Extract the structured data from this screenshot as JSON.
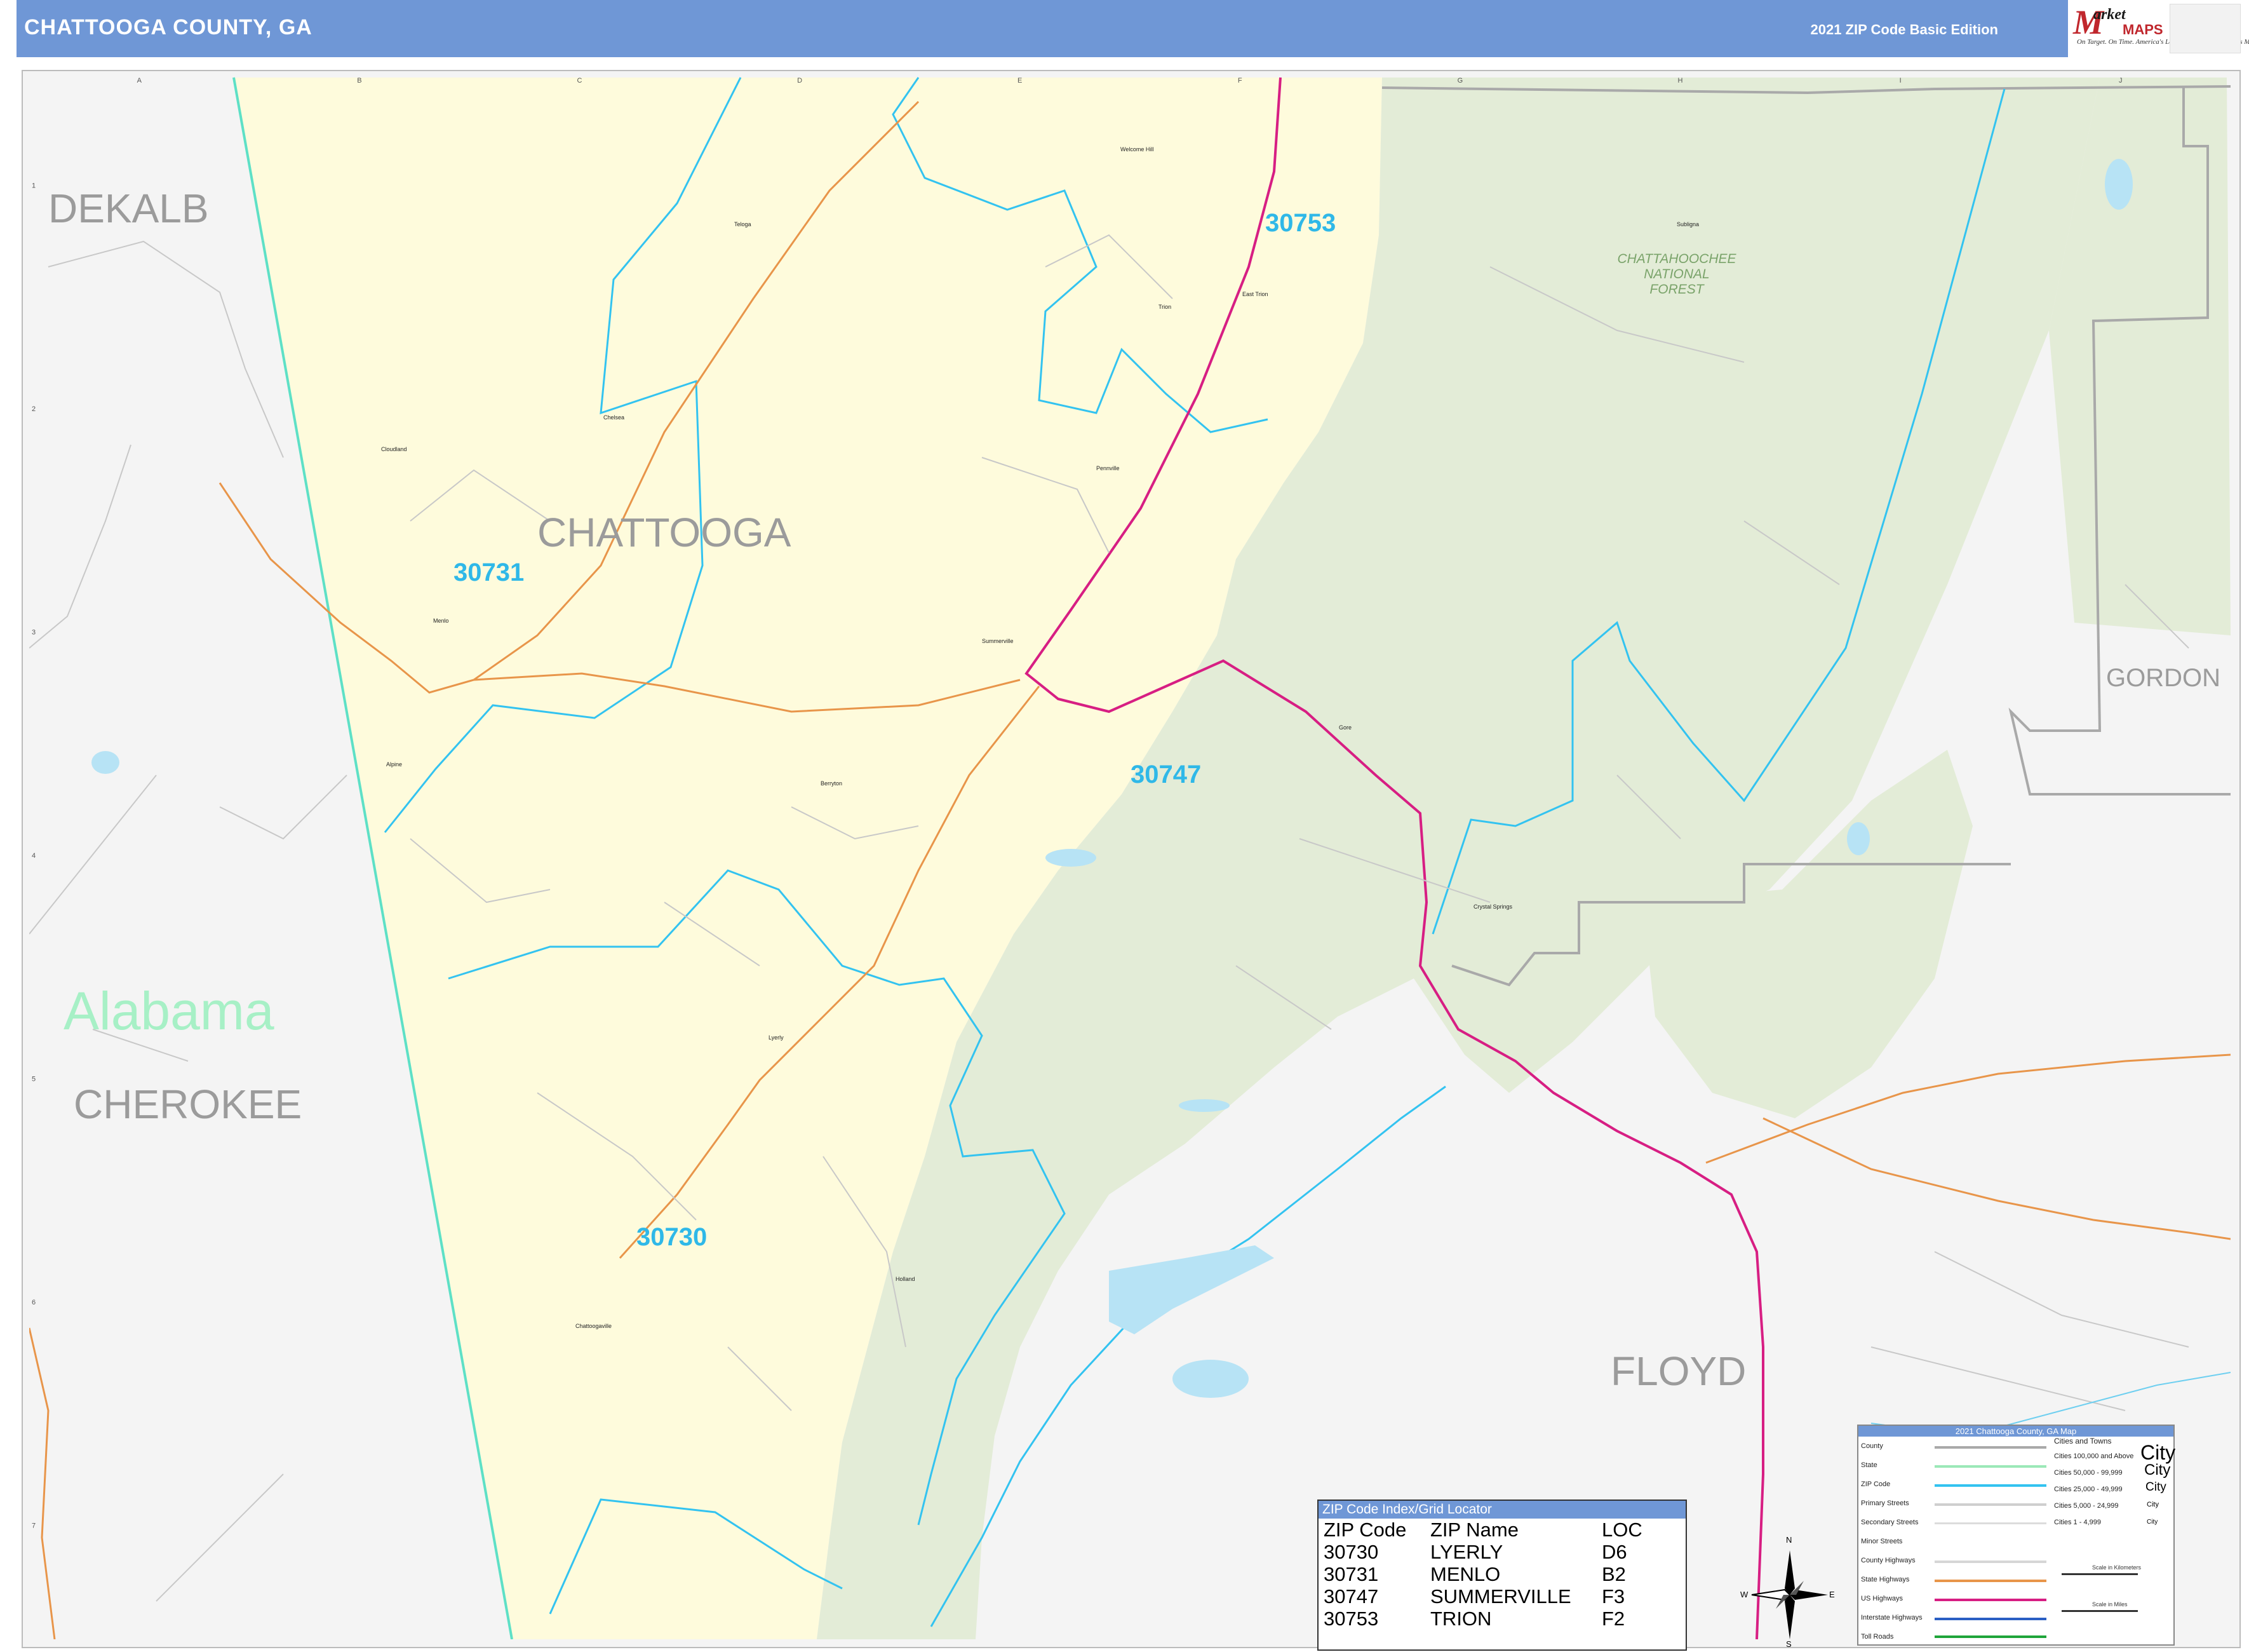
{
  "header": {
    "title": "CHATTOOGA COUNTY, GA",
    "edition": "2021 ZIP Code Basic Edition"
  },
  "logo": {
    "mark": "M",
    "market": "arket",
    "maps": "MAPS",
    "tagline": "On Target. On Time. America's Leading Source of Business Maps"
  },
  "grid": {
    "columns": [
      "A",
      "B",
      "C",
      "D",
      "E",
      "F",
      "G",
      "H",
      "I",
      "J"
    ],
    "rows": [
      "1",
      "2",
      "3",
      "4",
      "5",
      "6",
      "7"
    ]
  },
  "map": {
    "county_labels": [
      "DEKALB",
      "CHATTOOGA",
      "CHEROKEE",
      "FLOYD",
      "GORDON"
    ],
    "state_label": "Alabama",
    "zip_labels": [
      "30753",
      "30731",
      "30747",
      "30730"
    ],
    "forest_label": [
      "CHATTAHOOCHEE",
      "NATIONAL",
      "FOREST"
    ],
    "towns": [
      "Welcome Hill",
      "Teloga",
      "Trion",
      "East Trion",
      "Chelsea",
      "Cloudland",
      "Pennville",
      "Menlo",
      "Summerville",
      "Alpine",
      "Berryton",
      "Lyerly",
      "Chattoogaville",
      "Holland",
      "Subligna",
      "Gore",
      "Crystal Springs"
    ],
    "colors": {
      "chattooga_fill": "#fefbdc",
      "forest_fill": "#e3ecd7",
      "zip_border": "#33c3f0",
      "state_border": "#5ee0c6",
      "us_highway": "#d71e83",
      "state_highway": "#e8954a",
      "water": "#b7e3f5",
      "county_border": "#a9a9a9"
    }
  },
  "zip_index": {
    "title": "ZIP Code Index/Grid Locator",
    "headers": [
      "ZIP Code",
      "ZIP Name",
      "LOC"
    ],
    "rows": [
      [
        "30730",
        "LYERLY",
        "D6"
      ],
      [
        "30731",
        "MENLO",
        "B2"
      ],
      [
        "30747",
        "SUMMERVILLE",
        "F3"
      ],
      [
        "30753",
        "TRION",
        "F2"
      ]
    ]
  },
  "legend": {
    "title": "2021 Chattooga County, GA Map",
    "items": [
      "County",
      "State",
      "ZIP Code",
      "Primary Streets",
      "Secondary Streets",
      "Minor Streets",
      "County Highways",
      "State Highways",
      "US Highways",
      "Interstate Highways",
      "Toll Roads"
    ],
    "cities_title": "Cities and Towns",
    "cities": [
      "Cities 100,000 and Above",
      "Cities 50,000 - 99,999",
      "Cities 25,000 - 49,999",
      "Cities 5,000 - 24,999",
      "Cities 1 - 4,999"
    ],
    "city_samples": [
      "City",
      "City",
      "City",
      "City",
      "City"
    ],
    "scale_km": "Scale in Kilometers",
    "scale_mi": "Scale in Miles"
  },
  "compass": {
    "n": "N",
    "s": "S",
    "e": "E",
    "w": "W"
  }
}
